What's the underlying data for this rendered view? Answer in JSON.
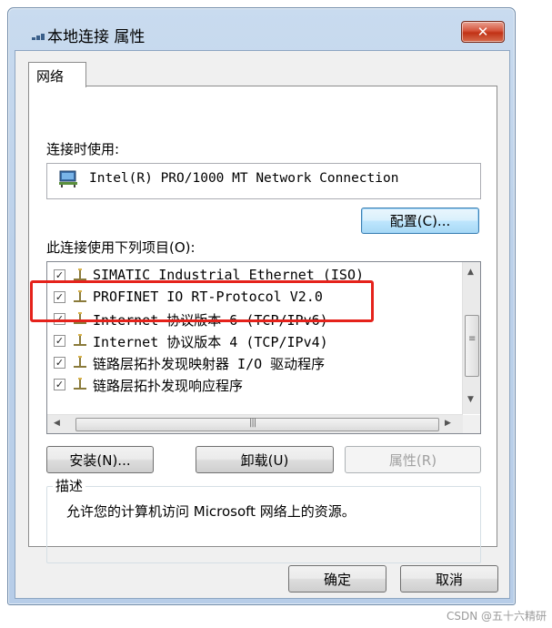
{
  "window": {
    "title": "本地连接 属性",
    "close_label": "✕"
  },
  "tabs": [
    {
      "label": "网络"
    }
  ],
  "connect_using": {
    "label": "连接时使用:",
    "adapter": "Intel(R) PRO/1000 MT Network Connection"
  },
  "configure_button": "配置(C)...",
  "items_label": "此连接使用下列项目(O):",
  "items": [
    {
      "label": "SIMATIC Industrial Ethernet (ISO)",
      "checked": true
    },
    {
      "label": "PROFINET IO RT-Protocol V2.0",
      "checked": true
    },
    {
      "label": "Internet 协议版本 6 (TCP/IPv6)",
      "checked": true
    },
    {
      "label": "Internet 协议版本 4 (TCP/IPv4)",
      "checked": true
    },
    {
      "label": "链路层拓扑发现映射器 I/O 驱动程序",
      "checked": true
    },
    {
      "label": "链路层拓扑发现响应程序",
      "checked": true
    }
  ],
  "buttons": {
    "install": "安装(N)...",
    "uninstall": "卸载(U)",
    "properties": "属性(R)"
  },
  "description": {
    "legend": "描述",
    "text": "允许您的计算机访问 Microsoft 网络上的资源。"
  },
  "footer": {
    "ok": "确定",
    "cancel": "取消"
  },
  "watermark": "CSDN @五十六精研",
  "colors": {
    "highlight": "#e5221b",
    "close_button": "#c13215"
  }
}
